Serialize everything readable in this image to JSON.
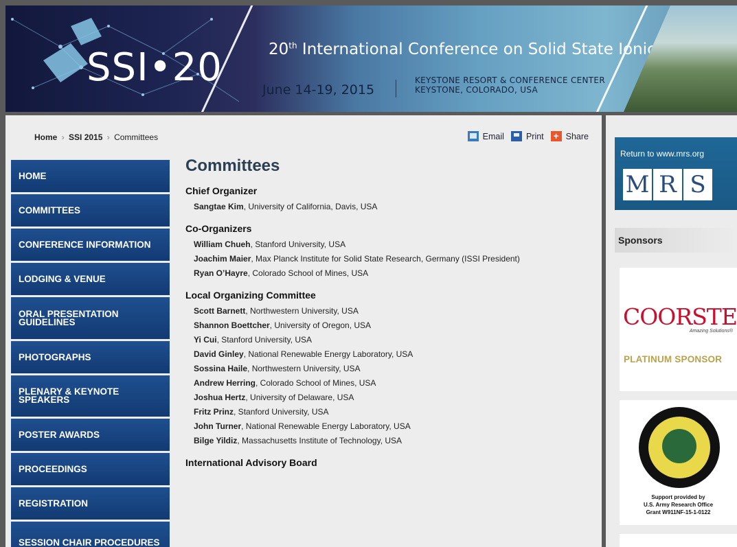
{
  "banner": {
    "logo": "SSI•20",
    "title_prefix": "20",
    "title_sup": "th",
    "title_rest": " International Conference on Solid State Ionics",
    "date": "June 14-19, 2015",
    "venue_line1": "KEYSTONE RESORT & CONFERENCE CENTER",
    "venue_line2": "KEYSTONE, COLORADO, USA"
  },
  "breadcrumb": {
    "home": "Home",
    "parent": "SSI 2015",
    "current": "Committees",
    "sep": "›"
  },
  "tools": {
    "email": "Email",
    "print": "Print",
    "share": "Share",
    "share_glyph": "+"
  },
  "nav": [
    {
      "label": "HOME"
    },
    {
      "label": "COMMITTEES"
    },
    {
      "label": "CONFERENCE INFORMATION"
    },
    {
      "label": "LODGING & VENUE"
    },
    {
      "label": "ORAL PRESENTATION GUIDELINES"
    },
    {
      "label": "PHOTOGRAPHS"
    },
    {
      "label": "PLENARY & KEYNOTE SPEAKERS"
    },
    {
      "label": "POSTER AWARDS"
    },
    {
      "label": "PROCEEDINGS"
    },
    {
      "label": "REGISTRATION"
    },
    {
      "label": "SESSION CHAIR PROCEDURES"
    }
  ],
  "page_title": "Committees",
  "sections": [
    {
      "title": "Chief Organizer",
      "members": [
        {
          "name": "Sangtae Kim",
          "affil": ", University of California, Davis, USA"
        }
      ]
    },
    {
      "title": "Co-Organizers",
      "members": [
        {
          "name": "William Chueh",
          "affil": ", Stanford University, USA"
        },
        {
          "name": "Joachim Maier",
          "affil": ", Max Planck Institute for Solid State Research, Germany (ISSI President)"
        },
        {
          "name": "Ryan O’Hayre",
          "affil": ", Colorado School of Mines, USA"
        }
      ]
    },
    {
      "title": "Local Organizing Committee",
      "members": [
        {
          "name": "Scott Barnett",
          "affil": ", Northwestern University, USA"
        },
        {
          "name": "Shannon Boettcher",
          "affil": ", University of Oregon, USA"
        },
        {
          "name": "Yi Cui",
          "affil": ", Stanford University, USA"
        },
        {
          "name": "David Ginley",
          "affil": ", National Renewable Energy Laboratory, USA"
        },
        {
          "name": "Sossina Haile",
          "affil": ", Northwestern University, USA"
        },
        {
          "name": "Andrew Herring",
          "affil": ", Colorado School of Mines, USA"
        },
        {
          "name": "Joshua Hertz",
          "affil": ", University of Delaware, USA"
        },
        {
          "name": "Fritz Prinz",
          "affil": ", Stanford University, USA"
        },
        {
          "name": "John Turner",
          "affil": ", National Renewable Energy Laboratory, USA"
        },
        {
          "name": "Bilge Yildiz",
          "affil": ", Massachusetts Institute of Technology, USA"
        }
      ]
    },
    {
      "title": "International Advisory Board",
      "members": []
    }
  ],
  "sidebar": {
    "mrs_return": "Return to www.mrs.org",
    "mrs_letters": [
      "M",
      "R",
      "S"
    ],
    "sponsors_heading": "Sponsors",
    "coorstek_logo": "COORSTEK",
    "coorstek_tagline": "Amazing Solutions®",
    "platinum": "PLATINUM SPONSOR",
    "army_caption_1": "Support provided by",
    "army_caption_2": "U.S. Army Research Office",
    "army_caption_3": "Grant W911NF-15-1-0122"
  }
}
